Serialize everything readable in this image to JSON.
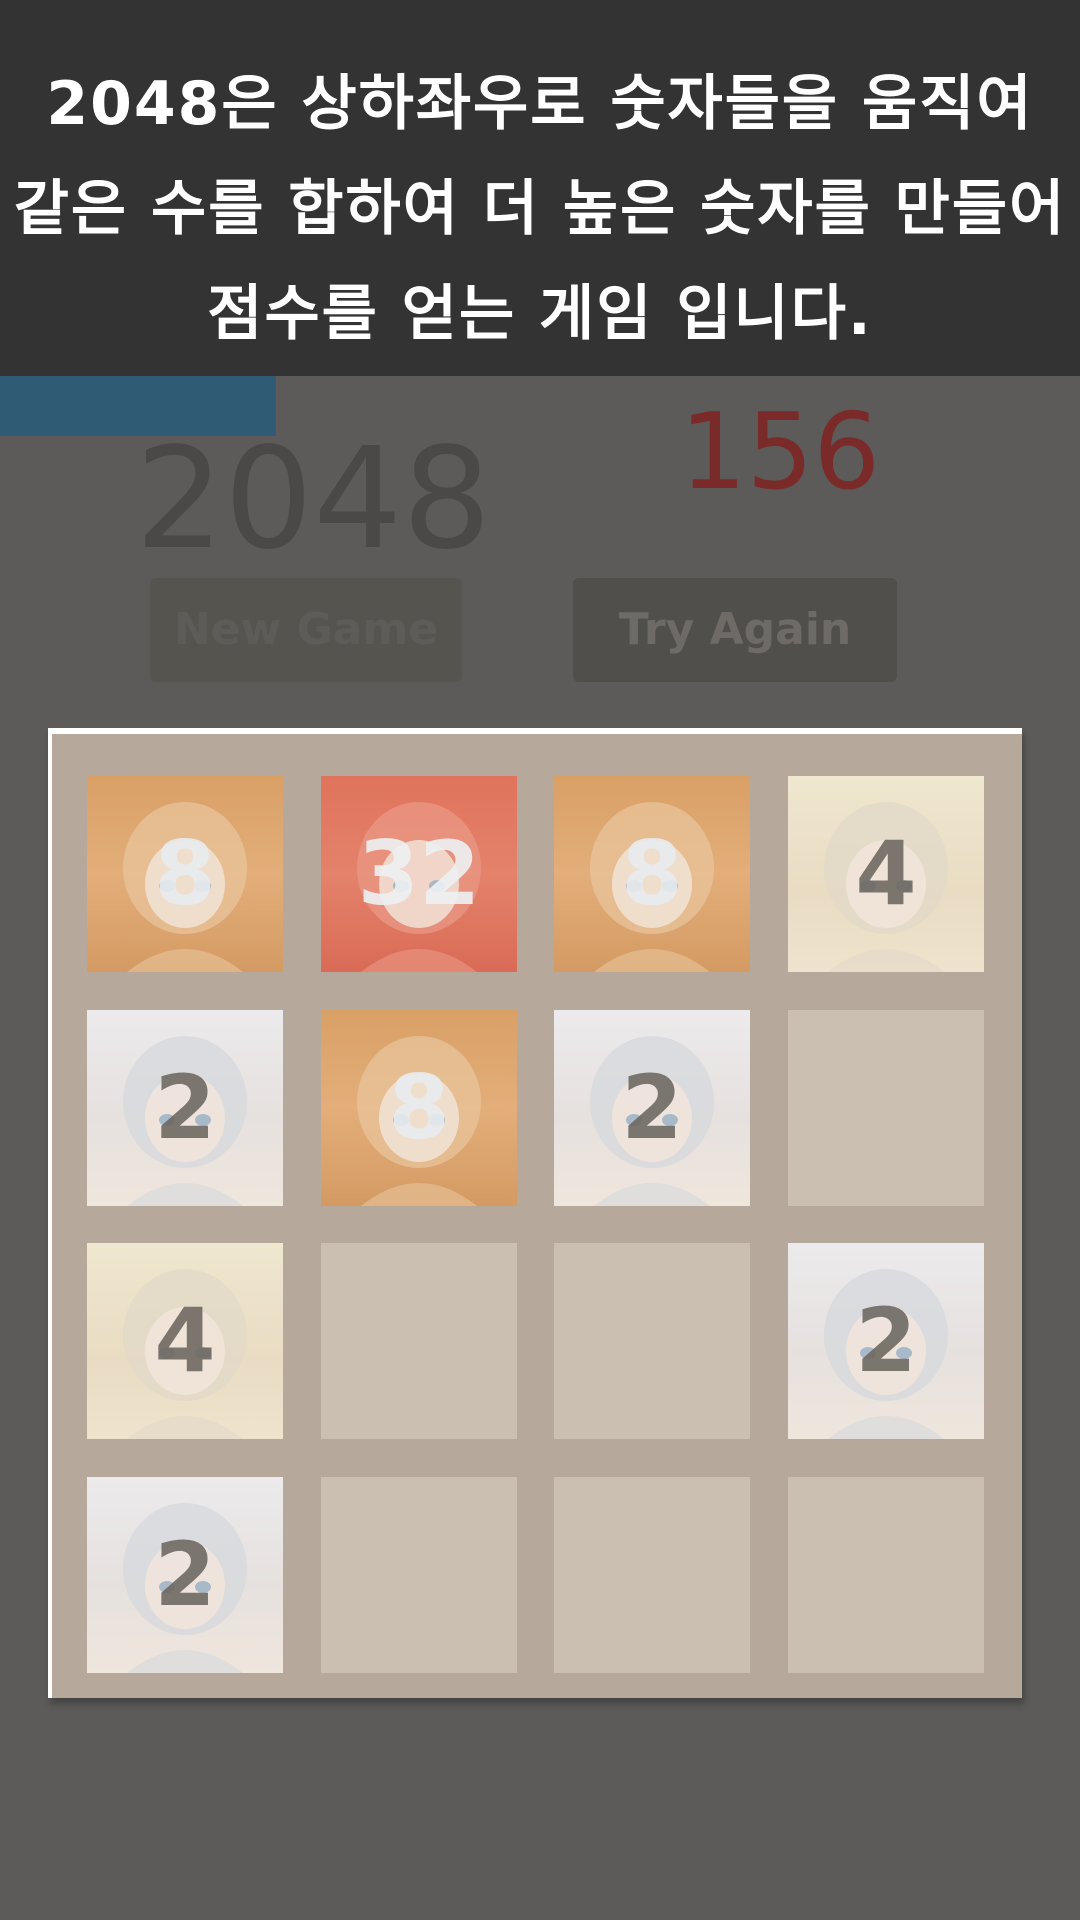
{
  "banner": {
    "line1": "2048은 상하좌우로 숫자들을 움직여",
    "line2": "같은 수를 합하여 더 높은 숫자를 만들어",
    "line3": "점수를 얻는 게임 입니다."
  },
  "header": {
    "title": "2048",
    "score": "156"
  },
  "buttons": {
    "new_game": "New Game",
    "try_again": "Try Again"
  },
  "board": {
    "grid": [
      [
        "8",
        "32",
        "8",
        "4"
      ],
      [
        "2",
        "8",
        "2",
        ""
      ],
      [
        "4",
        "",
        "",
        "2"
      ],
      [
        "2",
        "",
        "",
        ""
      ]
    ]
  },
  "colors": {
    "background": "#5c5b59",
    "banner": "#333333",
    "score": "#7a2a28",
    "board": "#b6a99c",
    "empty_cell": "#cbbfb1"
  }
}
